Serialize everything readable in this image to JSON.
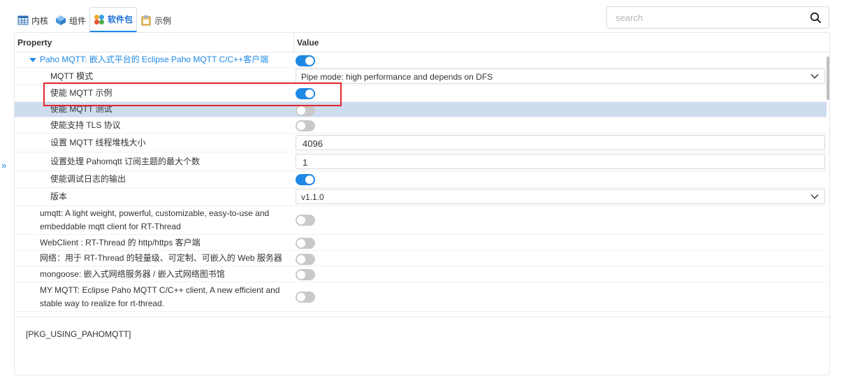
{
  "tabs": [
    {
      "label": "内核",
      "icon": "table-icon",
      "active": false
    },
    {
      "label": "组件",
      "icon": "cube-icon",
      "active": false
    },
    {
      "label": "软件包",
      "icon": "packages-icon",
      "active": true
    },
    {
      "label": "示例",
      "icon": "clipboard-icon",
      "active": false
    }
  ],
  "search": {
    "placeholder": "search",
    "value": ""
  },
  "grid": {
    "col_property": "Property",
    "col_value": "Value"
  },
  "rows": [
    {
      "label": "Paho MQTT: 嵌入式平台的 Eclipse Paho MQTT C/C++客户端",
      "kind": "toggle",
      "on": true,
      "expanded": true,
      "level": 0
    },
    {
      "label": "MQTT 模式",
      "kind": "select",
      "value": "Pipe mode: high performance and depends on DFS",
      "level": 1
    },
    {
      "label": "使能 MQTT 示例",
      "kind": "toggle",
      "on": true,
      "level": 1
    },
    {
      "label": "使能 MQTT 测试",
      "kind": "toggle",
      "on": false,
      "level": 1,
      "selected": true
    },
    {
      "label": "使能支持 TLS 协议",
      "kind": "toggle",
      "on": false,
      "level": 1
    },
    {
      "label": "设置 MQTT 线程堆栈大小",
      "kind": "number",
      "value": "4096",
      "level": 1
    },
    {
      "label": "设置处理 Pahomqtt 订阅主题的最大个数",
      "kind": "number",
      "value": "1",
      "level": 1
    },
    {
      "label": "使能调试日志的输出",
      "kind": "toggle",
      "on": true,
      "level": 1
    },
    {
      "label": "版本",
      "kind": "select",
      "value": "v1.1.0",
      "level": 1
    },
    {
      "label": "umqtt: A light weight, powerful, customizable, easy-to-use and embeddable mqtt client for RT-Thread",
      "kind": "toggle",
      "on": false,
      "level": 0
    },
    {
      "label": "WebClient : RT-Thread 的 http/https 客户端",
      "kind": "toggle",
      "on": false,
      "level": 0
    },
    {
      "label": "网络：用于 RT-Thread 的轻量级、可定制、可嵌入的 Web 服务器",
      "kind": "toggle",
      "on": false,
      "level": 0
    },
    {
      "label": "mongoose: 嵌入式网络服务器 / 嵌入式网络图书馆",
      "kind": "toggle",
      "on": false,
      "level": 0
    },
    {
      "label": "MY MQTT: Eclipse Paho MQTT C/C++ client, A new efficient and stable way to realize for rt-thread.",
      "kind": "toggle",
      "on": false,
      "level": 0
    }
  ],
  "description": "[PKG_USING_PAHOMQTT]",
  "colors": {
    "accent": "#1e88e5",
    "selected_row": "#cddcee",
    "highlight": "#e5252a"
  }
}
